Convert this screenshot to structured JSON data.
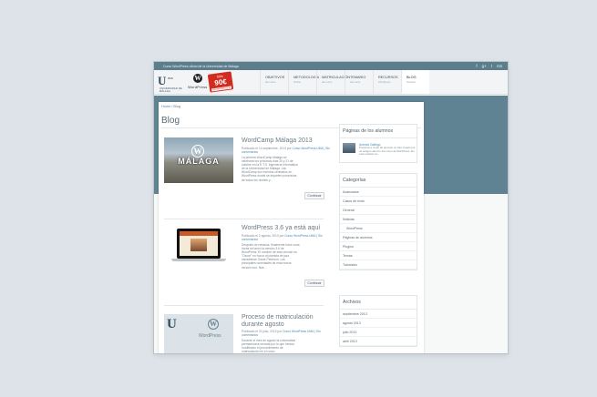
{
  "topbar": {
    "text": "Curso WordPress oficial de la Universidad de Málaga",
    "social": [
      "f",
      "g+",
      "t",
      "rss"
    ]
  },
  "logo": {
    "letter": "U",
    "ma": "ma",
    "sub": "UNIVERSIDAD DE MÁLAGA"
  },
  "wp_logo": {
    "glyph": "W",
    "text": "WordPress"
  },
  "promo": {
    "small": "Sólo",
    "price": "90€",
    "web": "cursowordpress.es"
  },
  "nav": [
    {
      "label": "Objetivos",
      "desc": "del curso"
    },
    {
      "label": "Metodología",
      "desc": "Online"
    },
    {
      "label": "Matriculación",
      "desc": "del curso"
    },
    {
      "label": "Temario",
      "desc": "del curso"
    },
    {
      "label": "Recursos",
      "desc": "Wordpress"
    },
    {
      "label": "Blog",
      "desc": "Noticias"
    }
  ],
  "breadcrumb": {
    "home": "Home",
    "sep": "/",
    "current": "Blog"
  },
  "page_title": "Blog",
  "posts": [
    {
      "title": "WordCamp Málaga 2013",
      "meta": "Publicado el 14 septiembre, 2013 por",
      "author": "Curso WordPress UMA",
      "comments": "Sin comentarios",
      "excerpt": "La primera WordCamp Málaga se celebrará los próximos días 20 y 21 de octubre en la E.T.S. Ingeniería Informática de la Universidad de Málaga. Las WordCamp son eventos centrados en WordPress donde se imparten ponencias de todos los niveles y...",
      "button": "Continuar",
      "image_text": "MÁLAGA",
      "image_glyph": "W"
    },
    {
      "title": "WordPress 3.6 ya está aquí",
      "meta": "Publicado el 2 agosto, 2013 por",
      "author": "Curso WordPress UMA",
      "comments": "Sin comentarios",
      "excerpt": "Después de retrasos, finalmente hace unas horas se lanzó la versión 3.6 de WordPress. El nombre de esta versión es \"Oscar\" en honor al pianista de jazz canadiense Oscar Peterson. Las principales novedades de esta nueva versión son: Nue...",
      "button": "Continuar"
    },
    {
      "title": "Proceso de matriculación durante agosto",
      "meta": "Publicado el 31 julio, 2013 por",
      "author": "Curso WordPress UMA",
      "comments": "Sin comentarios",
      "excerpt": "Durante el mes de agosto la universidad permanecerá cerrada por lo que hemos modificado el procedimiento de matriculación en el curso",
      "image_letter": "U",
      "image_glyph": "W",
      "image_text": "WordPress"
    }
  ],
  "sidebar": {
    "alumnos": {
      "title": "Páginas de los alumnos",
      "name": "Antonio Gallego",
      "desc": "Presenta a modo de ejemplo un sitio creado por un antiguo alumno del curso de WordPress. En esta ocasión es..."
    },
    "categorias": {
      "title": "Categorías",
      "items": [
        {
          "label": "Avanzados",
          "sub": false
        },
        {
          "label": "Casos de éxito",
          "sub": false
        },
        {
          "label": "General",
          "sub": false
        },
        {
          "label": "Noticias",
          "sub": false
        },
        {
          "label": "WordPress",
          "sub": true
        },
        {
          "label": "Páginas de alumnos",
          "sub": false
        },
        {
          "label": "Plugins",
          "sub": false
        },
        {
          "label": "Temas",
          "sub": false
        },
        {
          "label": "Tutoriales",
          "sub": false
        }
      ]
    },
    "archivos": {
      "title": "Archivos",
      "items": [
        "septiembre 2013",
        "agosto 2013",
        "julio 2013",
        "abril 2013"
      ]
    }
  }
}
